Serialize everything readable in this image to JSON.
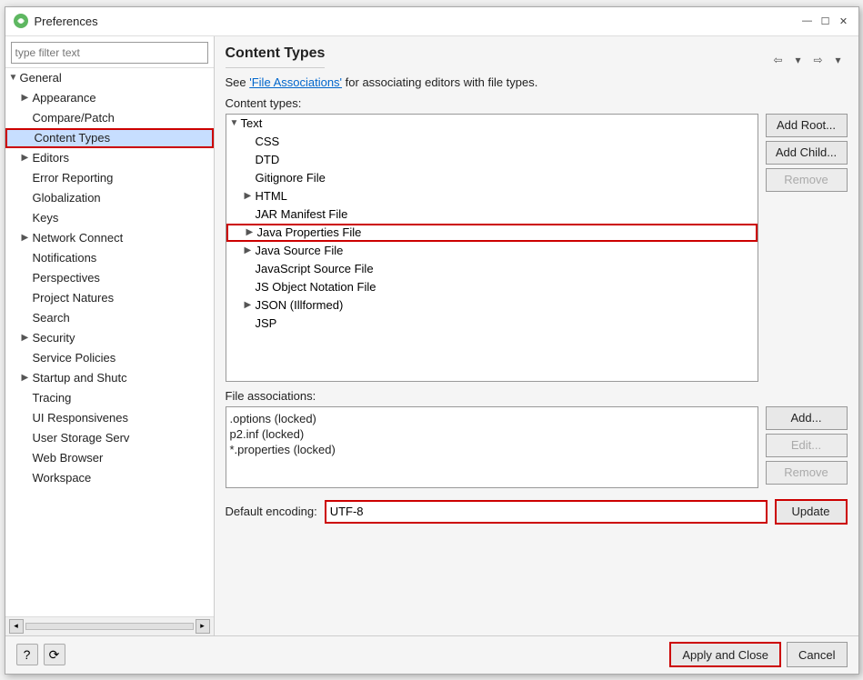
{
  "dialog": {
    "title": "Preferences",
    "icon": "⚙"
  },
  "filter": {
    "placeholder": "type filter text"
  },
  "sidebar": {
    "items": [
      {
        "id": "general",
        "label": "General",
        "level": 0,
        "expanded": true,
        "hasArrow": true
      },
      {
        "id": "appearance",
        "label": "Appearance",
        "level": 1,
        "expanded": false,
        "hasArrow": true
      },
      {
        "id": "compare-patch",
        "label": "Compare/Patch",
        "level": 1,
        "expanded": false,
        "hasArrow": false
      },
      {
        "id": "content-types",
        "label": "Content Types",
        "level": 1,
        "expanded": false,
        "hasArrow": false,
        "selected": true,
        "highlighted": true
      },
      {
        "id": "editors",
        "label": "Editors",
        "level": 1,
        "expanded": false,
        "hasArrow": true
      },
      {
        "id": "error-reporting",
        "label": "Error Reporting",
        "level": 1,
        "expanded": false,
        "hasArrow": false
      },
      {
        "id": "globalization",
        "label": "Globalization",
        "level": 1,
        "expanded": false,
        "hasArrow": false
      },
      {
        "id": "keys",
        "label": "Keys",
        "level": 1,
        "expanded": false,
        "hasArrow": false
      },
      {
        "id": "network-connect",
        "label": "Network Connect",
        "level": 1,
        "expanded": false,
        "hasArrow": true
      },
      {
        "id": "notifications",
        "label": "Notifications",
        "level": 1,
        "expanded": false,
        "hasArrow": false
      },
      {
        "id": "perspectives",
        "label": "Perspectives",
        "level": 1,
        "expanded": false,
        "hasArrow": false
      },
      {
        "id": "project-natures",
        "label": "Project Natures",
        "level": 1,
        "expanded": false,
        "hasArrow": false
      },
      {
        "id": "search",
        "label": "Search",
        "level": 1,
        "expanded": false,
        "hasArrow": false
      },
      {
        "id": "security",
        "label": "Security",
        "level": 1,
        "expanded": false,
        "hasArrow": true
      },
      {
        "id": "service-policies",
        "label": "Service Policies",
        "level": 1,
        "expanded": false,
        "hasArrow": false
      },
      {
        "id": "startup-shutdown",
        "label": "Startup and Shutc",
        "level": 1,
        "expanded": false,
        "hasArrow": true
      },
      {
        "id": "tracing",
        "label": "Tracing",
        "level": 1,
        "expanded": false,
        "hasArrow": false
      },
      {
        "id": "ui-responsiveness",
        "label": "UI Responsivenes",
        "level": 1,
        "expanded": false,
        "hasArrow": false
      },
      {
        "id": "user-storage",
        "label": "User Storage Serv",
        "level": 1,
        "expanded": false,
        "hasArrow": false
      },
      {
        "id": "web-browser",
        "label": "Web Browser",
        "level": 1,
        "expanded": false,
        "hasArrow": false
      },
      {
        "id": "workspace",
        "label": "Workspace",
        "level": 1,
        "expanded": false,
        "hasArrow": false
      }
    ]
  },
  "main": {
    "title": "Content Types",
    "info_text_before": "See ",
    "info_link": "'File Associations'",
    "info_text_after": " for associating editors with file types.",
    "content_types_label": "Content types:",
    "tree_items": [
      {
        "id": "text",
        "label": "Text",
        "level": 0,
        "hasArrow": true,
        "expanded": true
      },
      {
        "id": "css",
        "label": "CSS",
        "level": 1,
        "hasArrow": false
      },
      {
        "id": "dtd",
        "label": "DTD",
        "level": 1,
        "hasArrow": false
      },
      {
        "id": "gitignore",
        "label": "Gitignore File",
        "level": 1,
        "hasArrow": false
      },
      {
        "id": "html",
        "label": "HTML",
        "level": 1,
        "hasArrow": true
      },
      {
        "id": "jar-manifest",
        "label": "JAR Manifest File",
        "level": 1,
        "hasArrow": false
      },
      {
        "id": "java-properties",
        "label": "Java Properties File",
        "level": 1,
        "hasArrow": true,
        "selected": true,
        "highlighted": true
      },
      {
        "id": "java-source",
        "label": "Java Source File",
        "level": 1,
        "hasArrow": true
      },
      {
        "id": "javascript-source",
        "label": "JavaScript Source File",
        "level": 1,
        "hasArrow": false
      },
      {
        "id": "js-object-notation",
        "label": "JS Object Notation File",
        "level": 1,
        "hasArrow": false
      },
      {
        "id": "json-illformed",
        "label": "JSON (Illformed)",
        "level": 1,
        "hasArrow": true
      },
      {
        "id": "jsp",
        "label": "JSP",
        "level": 1,
        "hasArrow": false
      }
    ],
    "buttons_right": {
      "add_root": "Add Root...",
      "add_child": "Add Child...",
      "remove": "Remove"
    },
    "file_assoc_label": "File associations:",
    "file_associations": [
      ".options (locked)",
      "p2.inf (locked)",
      "*.properties (locked)"
    ],
    "file_assoc_buttons": {
      "add": "Add...",
      "edit": "Edit...",
      "remove": "Remove"
    },
    "encoding_label": "Default encoding:",
    "encoding_value": "UTF-8",
    "update_btn": "Update"
  },
  "bottom": {
    "apply_close": "Apply and Close",
    "cancel": "Cancel"
  }
}
